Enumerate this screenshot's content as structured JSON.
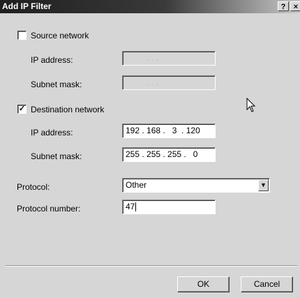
{
  "window": {
    "title": "Add IP Filter",
    "help_button": "?",
    "close_button": "×"
  },
  "source": {
    "checkbox_label": "Source network",
    "checked": false,
    "ip_label": "IP address:",
    "mask_label": "Subnet mask:",
    "ip_value": ". . .",
    "mask_value": ". . ."
  },
  "destination": {
    "checkbox_label": "Destination network",
    "checked": true,
    "check_glyph": "✓",
    "ip_label": "IP address:",
    "mask_label": "Subnet mask:",
    "ip_value": "192 . 168 .   3  . 120",
    "mask_value": "255 . 255 . 255 .   0"
  },
  "protocol": {
    "label": "Protocol:",
    "selected": "Other",
    "arrow": "▼"
  },
  "protocol_number": {
    "label": "Protocol number:",
    "value": "47"
  },
  "buttons": {
    "ok": "OK",
    "cancel": "Cancel"
  }
}
